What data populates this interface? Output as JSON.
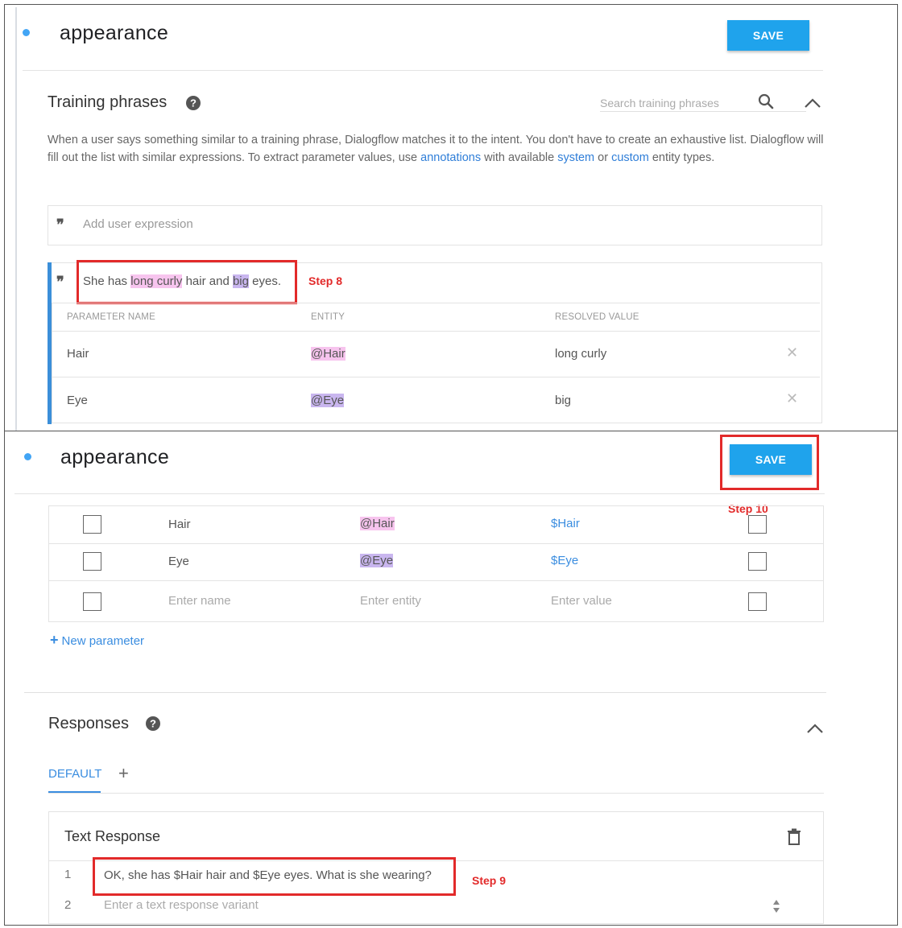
{
  "panel1": {
    "intent_name": "appearance",
    "save_label": "SAVE",
    "training": {
      "title": "Training phrases",
      "search_placeholder": "Search training phrases",
      "desc_part1": "When a user says something similar to a training phrase, Dialogflow matches it to the intent. You don't have to create an exhaustive list. Dialogflow will fill out the list with similar expressions. To extract parameter values, use ",
      "desc_link_annotations": "annotations",
      "desc_part2": " with available ",
      "desc_link_system": "system",
      "desc_part3": " or ",
      "desc_link_custom": "custom",
      "desc_part4": " entity types.",
      "add_expression_placeholder": "Add user expression",
      "phrase": {
        "t1": "She has ",
        "h1": "long curly",
        "t2": " hair and ",
        "h2": "big",
        "t3": " eyes."
      },
      "headers": {
        "parameter_name": "PARAMETER NAME",
        "entity": "ENTITY",
        "resolved_value": "RESOLVED VALUE"
      },
      "rows": [
        {
          "name": "Hair",
          "entity": "@Hair",
          "value": "long curly"
        },
        {
          "name": "Eye",
          "entity": "@Eye",
          "value": "big"
        }
      ],
      "step_label": "Step 8"
    }
  },
  "panel2": {
    "intent_name": "appearance",
    "save_label": "SAVE",
    "save_step_label": "Step 10",
    "params": [
      {
        "name": "Hair",
        "entity": "@Hair",
        "value": "$Hair"
      },
      {
        "name": "Eye",
        "entity": "@Eye",
        "value": "$Eye"
      }
    ],
    "new_row": {
      "name_placeholder": "Enter name",
      "entity_placeholder": "Enter entity",
      "value_placeholder": "Enter value"
    },
    "new_parameter_label": "New parameter",
    "responses": {
      "title": "Responses",
      "tab_default": "DEFAULT",
      "tab_add": "+",
      "text_response_title": "Text Response",
      "lines": [
        {
          "num": "1",
          "text": "OK, she has $Hair hair and $Eye eyes. What is she wearing?"
        },
        {
          "num": "2",
          "placeholder": "Enter a text response variant"
        }
      ],
      "step_label": "Step 9"
    }
  },
  "colors": {
    "accent_blue": "#1fa3ec",
    "link_blue": "#3a8de0",
    "annotation_red": "#e22a2a",
    "entity_pink": "#f7c4ee",
    "entity_purple": "#c9b6ef"
  }
}
